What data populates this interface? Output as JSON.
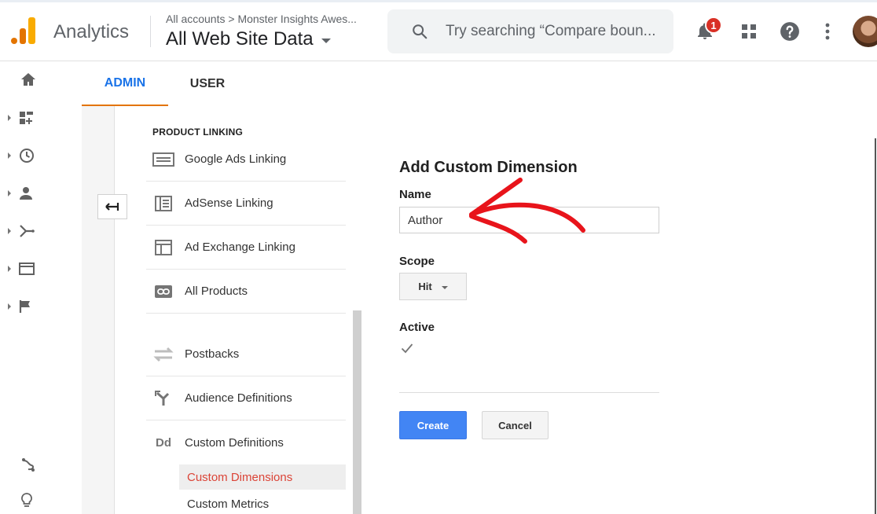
{
  "header": {
    "app_name": "Analytics",
    "breadcrumb": "All accounts > Monster Insights Awes...",
    "property": "All Web Site Data",
    "search_placeholder": "Try searching “Compare boun...",
    "notification_count": "1",
    "icons": [
      "search-icon",
      "bell-icon",
      "apps-icon",
      "help-icon",
      "more-vert-icon",
      "avatar"
    ]
  },
  "rail": {
    "items": [
      "home-icon",
      "customization-icon",
      "realtime-icon",
      "audience-icon",
      "acquisition-icon",
      "behavior-icon",
      "conversions-icon",
      "attribution-icon",
      "discover-icon"
    ]
  },
  "tabs": {
    "admin": "ADMIN",
    "user": "USER"
  },
  "nav": {
    "section_title": "PRODUCT LINKING",
    "items": [
      {
        "label": "Google Ads Linking",
        "icon": "google-ads-icon"
      },
      {
        "label": "AdSense Linking",
        "icon": "adsense-icon"
      },
      {
        "label": "Ad Exchange Linking",
        "icon": "ad-exchange-icon"
      },
      {
        "label": "All Products",
        "icon": "link-icon"
      },
      {
        "label": "Postbacks",
        "icon": "postbacks-icon"
      },
      {
        "label": "Audience Definitions",
        "icon": "audience-definitions-icon"
      },
      {
        "label": "Custom Definitions",
        "icon": "Dd"
      }
    ],
    "sub_items": [
      {
        "label": "Custom Dimensions",
        "active": true
      },
      {
        "label": "Custom Metrics",
        "active": false
      }
    ]
  },
  "form": {
    "title": "Add Custom Dimension",
    "name_label": "Name",
    "name_value": "Author",
    "scope_label": "Scope",
    "scope_value": "Hit",
    "active_label": "Active",
    "active_checked": true,
    "create_label": "Create",
    "cancel_label": "Cancel"
  },
  "colors": {
    "primary_blue": "#4285f4",
    "tab_blue": "#1a73e8",
    "accent_orange": "#e37400",
    "active_red": "#db4437",
    "annotation_red": "#e8141b"
  }
}
